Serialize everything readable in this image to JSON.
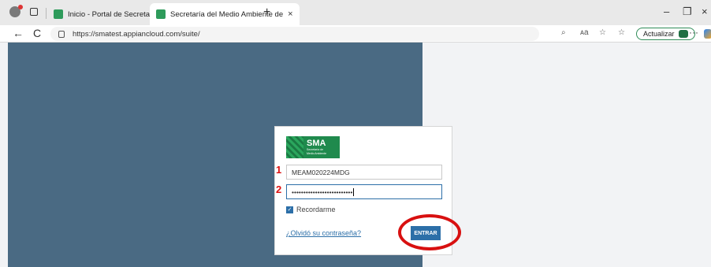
{
  "browser": {
    "tabs": [
      {
        "title": "Inicio - Portal de Secretaría de Me",
        "close": "×"
      },
      {
        "title": "Secretaría del Medio Ambiente de",
        "close": "×"
      }
    ],
    "new_tab": "+",
    "window_controls": {
      "minimize": "–",
      "restore": "❐",
      "close": "×"
    },
    "address": {
      "url": "https://smatest.appiancloud.com/suite/"
    },
    "nav": {
      "back": "←",
      "refresh": "C"
    },
    "toolbar": {
      "update_label": "Actualizar",
      "more": "···"
    }
  },
  "login": {
    "logo": {
      "title": "SMA",
      "subtitle_line1": "Secretaría de",
      "subtitle_line2": "Medio Ambiente"
    },
    "username": {
      "value": "MEAM020224MDG",
      "marker": "1"
    },
    "password": {
      "value": "••••••••••••••••••••••••••",
      "marker": "2"
    },
    "remember": {
      "label": "Recordarme",
      "checked": true
    },
    "forgot_link": "¿Olvidó su contraseña?",
    "submit_label": "ENTRAR"
  },
  "colors": {
    "panel": "#4a6a83",
    "accent": "#2c6fa8",
    "brand_green": "#1f8a4d",
    "highlight": "#d81010"
  }
}
